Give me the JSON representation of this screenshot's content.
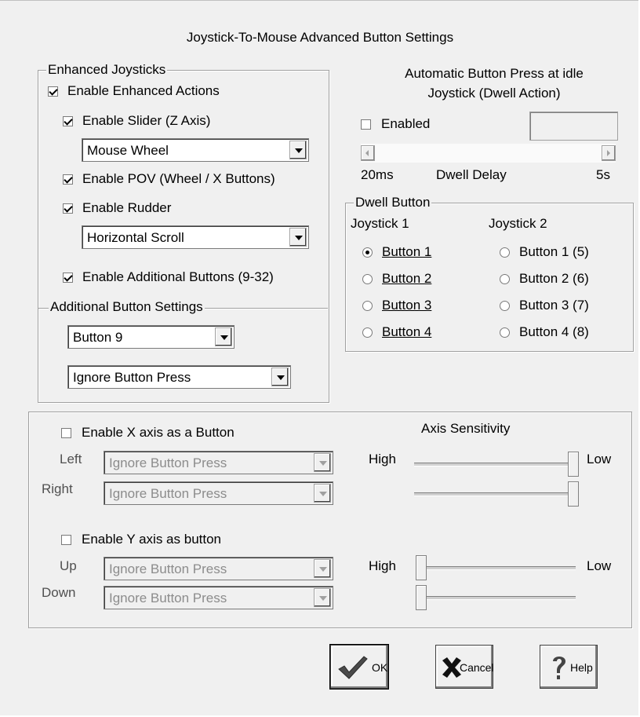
{
  "title": "Joystick-To-Mouse Advanced Button Settings",
  "enhanced": {
    "group_title": "Enhanced Joysticks",
    "enable_actions": {
      "label": "Enable Enhanced Actions",
      "checked": true
    },
    "enable_slider": {
      "label": "Enable Slider (Z Axis)",
      "checked": true
    },
    "slider_mode": "Mouse Wheel",
    "enable_pov": {
      "label": "Enable POV (Wheel / X Buttons)",
      "checked": true
    },
    "enable_rudder": {
      "label": "Enable Rudder",
      "checked": true
    },
    "rudder_mode": "Horizontal Scroll",
    "enable_additional": {
      "label": "Enable Additional Buttons (9-32)",
      "checked": true
    },
    "additional_title": "Additional Button Settings",
    "button_select": "Button 9",
    "button_action": "Ignore Button Press"
  },
  "dwell": {
    "header_line1": "Automatic Button Press at idle",
    "header_line2": "Joystick (Dwell Action)",
    "enabled": {
      "label": "Enabled",
      "checked": false
    },
    "min_label": "20ms",
    "delay_label": "Dwell Delay",
    "max_label": "5s",
    "button_group_title": "Dwell Button",
    "joystick1_label": "Joystick 1",
    "joystick2_label": "Joystick 2",
    "joystick1_buttons": [
      "Button 1",
      "Button 2",
      "Button 3",
      "Button 4"
    ],
    "joystick2_buttons": [
      "Button 1 (5)",
      "Button 2 (6)",
      "Button 3 (7)",
      "Button 4 (8)"
    ],
    "selected": "Button 1"
  },
  "axis": {
    "sensitivity_label": "Axis Sensitivity",
    "enable_x": {
      "label": "Enable X axis as a Button",
      "checked": false
    },
    "left_label": "Left",
    "right_label": "Right",
    "left_value": "Ignore Button Press",
    "right_value": "Ignore Button Press",
    "enable_y": {
      "label": "Enable Y axis as button",
      "checked": false
    },
    "up_label": "Up",
    "down_label": "Down",
    "up_value": "Ignore Button Press",
    "down_value": "Ignore Button Press",
    "high_label": "High",
    "low_label": "Low",
    "x_left_sensitivity": 1.0,
    "x_right_sensitivity": 1.0,
    "y_up_sensitivity": 0.0,
    "y_down_sensitivity": 0.0
  },
  "buttons": {
    "ok": "OK",
    "cancel": "Cancel",
    "help": "Help"
  }
}
